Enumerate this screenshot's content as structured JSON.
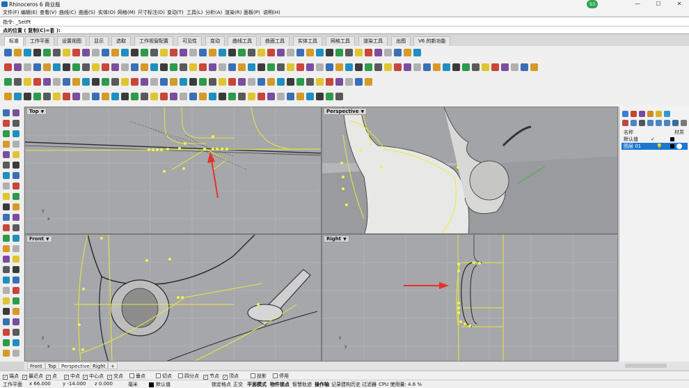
{
  "window": {
    "title": "Rhinoceros 6 商业版",
    "badge": "53"
  },
  "menu": [
    "文件(F)",
    "编辑(E)",
    "查看(V)",
    "曲线(C)",
    "曲面(S)",
    "实体(O)",
    "网格(M)",
    "尺寸标注(D)",
    "变动(T)",
    "工具(L)",
    "分析(A)",
    "渲染(R)",
    "面板(P)",
    "说明(H)"
  ],
  "command": {
    "history": "指令: _SetPt",
    "prompt": "点的位置 ( 复制(C)=否 ):"
  },
  "tabs": [
    "标准",
    "工作平面",
    "设置视图",
    "显示",
    "选取",
    "工作视窗配置",
    "可见性",
    "变动",
    "曲线工具",
    "曲面工具",
    "实体工具",
    "网格工具",
    "渲染工具",
    "出图",
    "V6 的新功能"
  ],
  "viewports": {
    "top": "Top",
    "perspective": "Perspective",
    "front": "Front",
    "right": "Right"
  },
  "viewport_tabs": [
    "Front",
    "Top",
    "Perspective",
    "Right",
    "+"
  ],
  "osnaps": [
    {
      "label": "端点",
      "checked": true
    },
    {
      "label": "最近点",
      "checked": true
    },
    {
      "label": "点",
      "checked": true
    },
    {
      "label": "中点",
      "checked": true
    },
    {
      "label": "中心点",
      "checked": true
    },
    {
      "label": "交点",
      "checked": true
    },
    {
      "label": "垂点",
      "checked": false
    },
    {
      "label": "切点",
      "checked": false
    },
    {
      "label": "四分点",
      "checked": false
    },
    {
      "label": "节点",
      "checked": true
    },
    {
      "label": "顶点",
      "checked": true
    },
    {
      "label": "投影",
      "checked": false
    },
    {
      "label": "停用",
      "checked": false
    }
  ],
  "status": {
    "cplane": "工作平面",
    "x": "x 66.000",
    "y": "y -14.000",
    "z": "z 0.000",
    "unit": "毫米",
    "layer": "默认值",
    "lock_grid": "锁定格点",
    "ortho": "正交",
    "planar": "平面模式",
    "osnap": "物件锁点",
    "smarttrack": "智慧轨迹",
    "gumball": "操作轴",
    "history": "记录建构历史",
    "filter": "过滤器",
    "cpu": "CPU 使用量: 4.6 %"
  },
  "layers_panel": {
    "header_name": "名称",
    "header_material": "材质",
    "rows": [
      {
        "name": "默认值",
        "current": true,
        "selected": false
      },
      {
        "name": "图层 01",
        "current": false,
        "selected": true
      }
    ]
  },
  "colors": {
    "viewport_bg": "#a5a7aa",
    "curve_yellow": "#f0f03a",
    "annotation_arrow": "#e8302a",
    "selection_blue": "#1c77d0"
  }
}
